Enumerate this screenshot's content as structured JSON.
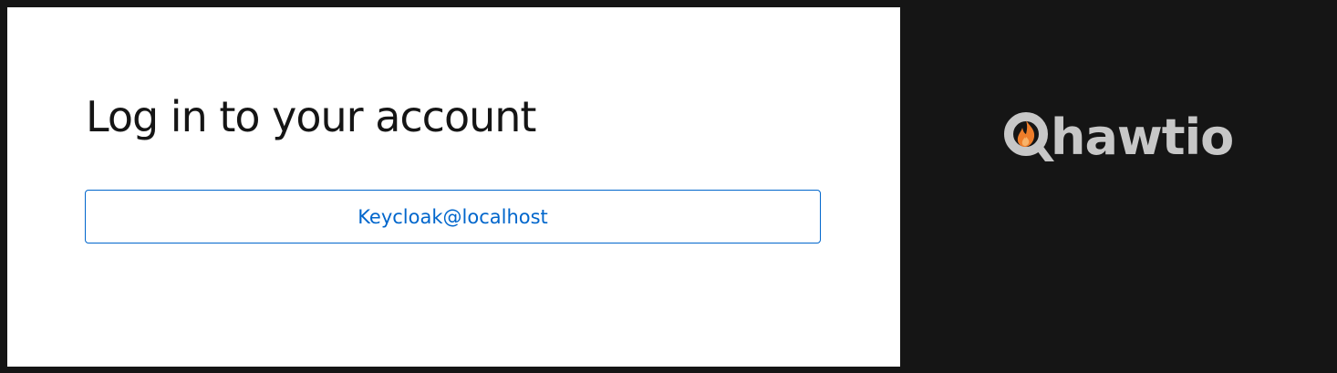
{
  "login": {
    "title": "Log in to your account",
    "providers": [
      {
        "label": "Keycloak@localhost"
      }
    ]
  },
  "brand": {
    "name": "hawtio",
    "logo_icon": "magnifier-flame-icon",
    "colors": {
      "wordmark": "#c7c7c7",
      "flame": "#ee7d2a",
      "background": "#151515"
    }
  },
  "colors": {
    "accent": "#0066cc",
    "card_background": "#ffffff",
    "page_background": "#151515",
    "title_text": "#151515"
  }
}
